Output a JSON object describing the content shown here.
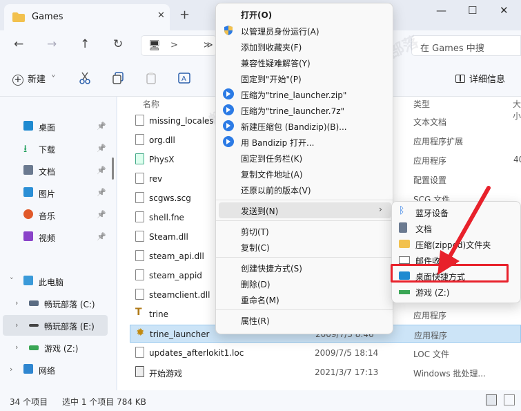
{
  "window": {
    "tab_title": "Games",
    "tab_close": "✕",
    "new_tab": "+",
    "minimize": "—",
    "maximize": "☐",
    "close": "✕"
  },
  "nav": {
    "back": "←",
    "forward": "→",
    "up": "↑",
    "refresh": "↻",
    "address_seg": "≫",
    "address_sep": ">",
    "search_placeholder": "在 Games 中搜"
  },
  "toolbar": {
    "new_label": "新建",
    "new_plus": "+",
    "new_dropdown": "˅",
    "details_label": "详细信息"
  },
  "sidebar": {
    "items": [
      {
        "label": "桌面",
        "pin": "📌"
      },
      {
        "label": "下载",
        "pin": "📌"
      },
      {
        "label": "文档",
        "pin": "📌"
      },
      {
        "label": "图片",
        "pin": "📌"
      },
      {
        "label": "音乐",
        "pin": "📌"
      },
      {
        "label": "视频",
        "pin": "📌"
      }
    ],
    "this_pc": "此电脑",
    "drives": [
      {
        "label": "畅玩部落 (C:)"
      },
      {
        "label": "畅玩部落 (E:)"
      },
      {
        "label": "游戏 (Z:)"
      }
    ],
    "network": "网络",
    "expanded": "˅",
    "collapsed": "›"
  },
  "columns": {
    "name": "名称",
    "type": "类型",
    "size": "大小"
  },
  "files": [
    {
      "name": "missing_locales",
      "date": "",
      "type": "文本文档",
      "size": ""
    },
    {
      "name": "org.dll",
      "date": "",
      "type": "应用程序扩展",
      "size": ""
    },
    {
      "name": "PhysX",
      "date": "",
      "type": "应用程序",
      "size": "40"
    },
    {
      "name": "rev",
      "date": "",
      "type": "配置设置",
      "size": ""
    },
    {
      "name": "scgws.scg",
      "date": "",
      "type": "SCG 文件",
      "size": ""
    },
    {
      "name": "shell.fne",
      "date": "",
      "type": "",
      "size": ""
    },
    {
      "name": "Steam.dll",
      "date": "",
      "type": "",
      "size": ""
    },
    {
      "name": "steam_api.dll",
      "date": "",
      "type": "",
      "size": ""
    },
    {
      "name": "steam_appid",
      "date": "",
      "type": "",
      "size": ""
    },
    {
      "name": "steamclient.dll",
      "date": "",
      "type": "",
      "size": ""
    },
    {
      "name": "trine",
      "date": "",
      "type": "应用程序",
      "size": ""
    },
    {
      "name": "trine_launcher",
      "date": "2009/7/3 8:46",
      "type": "应用程序",
      "size": ""
    },
    {
      "name": "updates_afterlokit1.loc",
      "date": "2009/7/5 18:14",
      "type": "LOC 文件",
      "size": ""
    },
    {
      "name": "开始游戏",
      "date": "2021/3/7 17:13",
      "type": "Windows 批处理...",
      "size": ""
    }
  ],
  "context_menu": {
    "items": [
      {
        "label": "打开(O)"
      },
      {
        "label": "以管理员身份运行(A)"
      },
      {
        "label": "添加到收藏夹(F)"
      },
      {
        "label": "兼容性疑难解答(Y)"
      },
      {
        "label": "固定到\"开始\"(P)"
      },
      {
        "label": "压缩为\"trine_launcher.zip\""
      },
      {
        "label": "压缩为\"trine_launcher.7z\""
      },
      {
        "label": "新建压缩包 (Bandizip)(B)..."
      },
      {
        "label": "用 Bandizip 打开..."
      },
      {
        "label": "固定到任务栏(K)"
      },
      {
        "label": "复制文件地址(A)"
      },
      {
        "label": "还原以前的版本(V)"
      },
      {
        "label": "发送到(N)"
      },
      {
        "label": "剪切(T)"
      },
      {
        "label": "复制(C)"
      },
      {
        "label": "创建快捷方式(S)"
      },
      {
        "label": "删除(D)"
      },
      {
        "label": "重命名(M)"
      },
      {
        "label": "属性(R)"
      }
    ],
    "submenu_arrow": "›"
  },
  "sendto_menu": {
    "items": [
      {
        "label": "蓝牙设备"
      },
      {
        "label": "文档"
      },
      {
        "label": "压缩(zipped)文件夹"
      },
      {
        "label": "邮件收件人"
      },
      {
        "label": "桌面快捷方式"
      },
      {
        "label": "游戏 (Z:)"
      }
    ]
  },
  "status": {
    "count": "34 个项目",
    "selection": "选中 1 个项目  784 KB"
  },
  "colors": {
    "accent": "#2c7be5",
    "highlight_box": "#e8212b",
    "selection": "#cce4f7"
  }
}
